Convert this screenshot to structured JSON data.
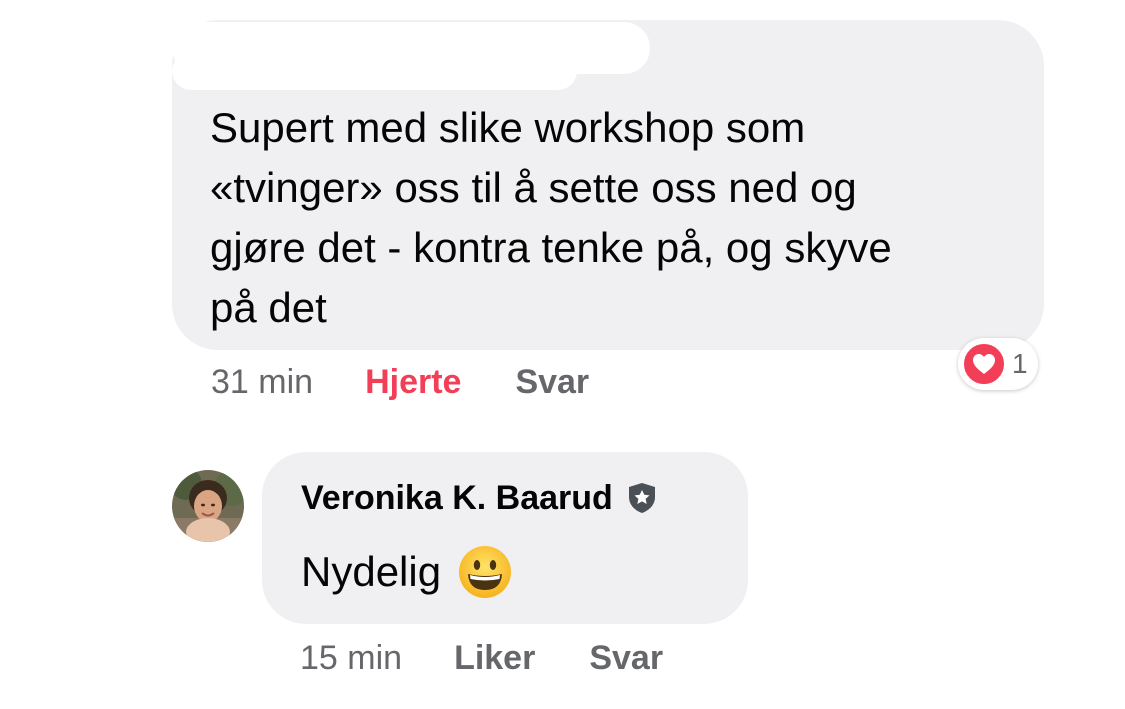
{
  "comment1": {
    "text": "Supert med slike workshop som\n«tvinger» oss til å sette oss ned og\ngjøre det - kontra tenke på, og skyve\npå det",
    "time": "31 min",
    "reaction_label": "Hjerte",
    "reply_label": "Svar",
    "reaction_count": "1",
    "reaction_icon": "heart-icon",
    "reaction_color": "#f33e58"
  },
  "reply": {
    "author": "Veronika K. Baarud",
    "badge_icon": "shield-star-icon",
    "text": "Nydelig",
    "emoji_icon": "grinning-face-emoji",
    "time": "15 min",
    "like_label": "Liker",
    "reply_label": "Svar"
  },
  "colors": {
    "bubble": "#f0f0f2",
    "secondary_text": "#65676b",
    "heart_red": "#f33e58"
  }
}
